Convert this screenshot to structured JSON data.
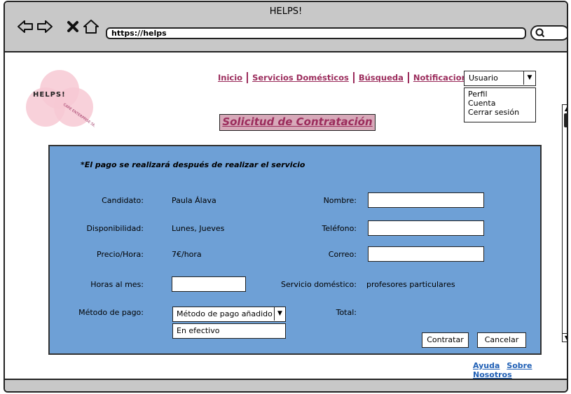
{
  "window": {
    "title": "HELPS!"
  },
  "toolbar": {
    "url": "https://helps",
    "back_icon": "back-arrow-icon",
    "forward_icon": "forward-arrow-icon",
    "close_icon": "close-x-icon",
    "home_icon": "home-icon",
    "search_icon": "search-icon"
  },
  "logo": {
    "name": "HELPS!",
    "tagline": "CARE ENTERPRISE SERVICES"
  },
  "nav": {
    "items": [
      {
        "label": "Inicio"
      },
      {
        "label": "Servicios Domésticos"
      },
      {
        "label": "Búsqueda"
      },
      {
        "label": "Notificaciones"
      }
    ]
  },
  "user_menu": {
    "selected": "Usuario",
    "options": [
      "Perfil",
      "Cuenta",
      "Cerrar sesión"
    ]
  },
  "page": {
    "title": "Solicitud de Contratación"
  },
  "form": {
    "note": "*El pago se realizará después de realizar el servicio",
    "candidate_label": "Candidato:",
    "candidate_value": "Paula Álava",
    "availability_label": "Disponibilidad:",
    "availability_value": "Lunes, Jueves",
    "price_label": "Precio/Hora:",
    "price_value": "7€/hora",
    "hours_label": "Horas al mes:",
    "hours_value": "",
    "payment_label": "Método de pago:",
    "payment_selected": "Método de pago añadido",
    "payment_options": [
      "En efectivo"
    ],
    "name_label": "Nombre:",
    "phone_label": "Teléfono:",
    "email_label": "Correo:",
    "service_label": "Servicio doméstico:",
    "service_value": "profesores particulares",
    "total_label": "Total:",
    "total_value": "",
    "submit_label": "Contratar",
    "cancel_label": "Cancelar"
  },
  "footer": {
    "links": [
      {
        "label": "Ayuda"
      },
      {
        "label": "Sobre Nosotros"
      }
    ]
  },
  "colors": {
    "accent": "#9b2c5c",
    "panel": "#6ea0d6",
    "title_bg": "#d7a9b9",
    "link": "#1f5fb5"
  }
}
